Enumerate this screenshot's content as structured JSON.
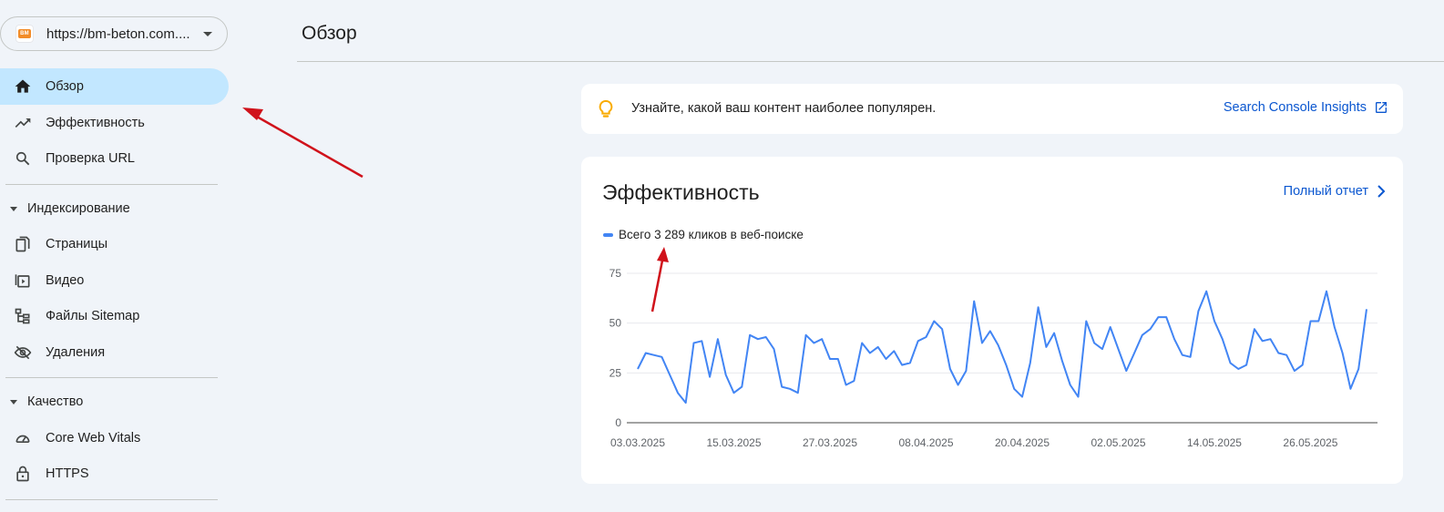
{
  "property": {
    "favicon_text": "BM",
    "url": "https://bm-beton.com...."
  },
  "sidebar": {
    "items_top": [
      {
        "label": "Обзор",
        "icon": "home-icon"
      },
      {
        "label": "Эффективность",
        "icon": "trending-up-icon"
      },
      {
        "label": "Проверка URL",
        "icon": "search-icon"
      }
    ],
    "section_indexing": {
      "label": "Индексирование",
      "items": [
        {
          "label": "Страницы",
          "icon": "pages-icon"
        },
        {
          "label": "Видео",
          "icon": "video-icon"
        },
        {
          "label": "Файлы Sitemap",
          "icon": "sitemap-icon"
        },
        {
          "label": "Удаления",
          "icon": "visibility-off-icon"
        }
      ]
    },
    "section_quality": {
      "label": "Качество",
      "items": [
        {
          "label": "Core Web Vitals",
          "icon": "speed-icon"
        },
        {
          "label": "HTTPS",
          "icon": "lock-icon"
        }
      ]
    }
  },
  "header": {
    "title": "Обзор"
  },
  "insights": {
    "text": "Узнайте, какой ваш контент наиболее популярен.",
    "link_label": "Search Console Insights"
  },
  "performance": {
    "title": "Эффективность",
    "full_report_label": "Полный отчет",
    "legend_label": "Всего 3 289 кликов в веб-поиске"
  },
  "colors": {
    "accent": "#0b57d0",
    "series": "#4285f4",
    "active_nav": "#c2e7ff",
    "annotation": "#d0121b"
  },
  "chart_data": {
    "type": "line",
    "ylim": [
      0,
      75
    ],
    "yticks": [
      0,
      25,
      50,
      75
    ],
    "x_tick_labels": [
      "03.03.2025",
      "15.03.2025",
      "27.03.2025",
      "08.04.2025",
      "20.04.2025",
      "02.05.2025",
      "14.05.2025",
      "26.05.2025"
    ],
    "x_start": "2025-03-03",
    "x_end": "2025-06-02",
    "grid": true,
    "series": [
      {
        "values": [
          27,
          35,
          34,
          33,
          24,
          15,
          10,
          40,
          41,
          23,
          42,
          24,
          15,
          18,
          44,
          42,
          43,
          37,
          18,
          17,
          15,
          44,
          40,
          42,
          32,
          32,
          19,
          21,
          40,
          35,
          38,
          32,
          36,
          29,
          30,
          41,
          43,
          51,
          47,
          27,
          19,
          26,
          61,
          40,
          46,
          39,
          29,
          17,
          13,
          30,
          58,
          38,
          45,
          31,
          19,
          13,
          51,
          40,
          37,
          48,
          37,
          26,
          35,
          44,
          47,
          53,
          53,
          42,
          34,
          33,
          56,
          66,
          51,
          42,
          30,
          27,
          29,
          47,
          41,
          42,
          35,
          34,
          26,
          29,
          51,
          51,
          66,
          48,
          35,
          17,
          27,
          57
        ]
      }
    ]
  }
}
